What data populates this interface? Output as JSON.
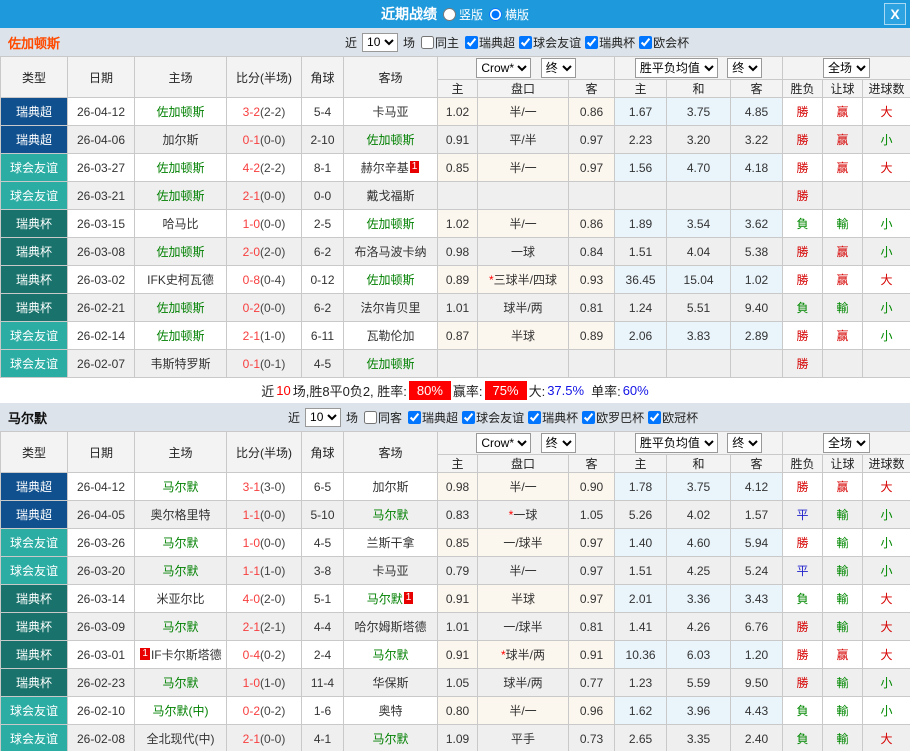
{
  "titlebar": {
    "title": "近期战绩",
    "layout_options": [
      {
        "label": "竖版",
        "checked": false
      },
      {
        "label": "横版",
        "checked": true
      }
    ],
    "close_label": "X"
  },
  "colors": {
    "header_blue": "#1e9adc",
    "section_bar": "#dce3ea",
    "league_superettan_blue": "#10508e",
    "friendly_teal": "#2bada4",
    "cup_dark_teal": "#19736c",
    "win_red": "#d60000",
    "lose_green": "#008800",
    "draw_blue": "#2222cc",
    "focus_team_green": "#008000",
    "score_red": "#f83e3e"
  },
  "table_header": {
    "type": "类型",
    "date": "日期",
    "home": "主场",
    "score": "比分(半场)",
    "corner": "角球",
    "away": "客场",
    "odds_select": "Crow*",
    "final_select": "终",
    "avg_select": "胜平负均值",
    "final_select2": "终",
    "full_select": "全场",
    "sub": [
      "主",
      "盘口",
      "客",
      "主",
      "和",
      "客",
      "胜负",
      "让球",
      "进球数"
    ]
  },
  "sections": [
    {
      "team": "佐加顿斯",
      "filter": {
        "near": "近",
        "count": "10",
        "unit": "场",
        "same": "同主",
        "same_checked": false,
        "leagues": [
          {
            "label": "瑞典超",
            "checked": true
          },
          {
            "label": "球会友谊",
            "checked": true
          },
          {
            "label": "瑞典杯",
            "checked": true
          },
          {
            "label": "欧会杯",
            "checked": true
          }
        ]
      },
      "rows": [
        {
          "type": "瑞典超",
          "type_color": "#10508e",
          "date": "26-04-12",
          "home": "佐加顿斯",
          "home_green": true,
          "away": "卡马亚",
          "away_green": false,
          "score": "3-2",
          "half": "(2-2)",
          "corner": "5-4",
          "water_home": "1.02",
          "handicap": "半/一",
          "water_away": "0.86",
          "avg_home": "1.67",
          "avg_draw": "3.75",
          "avg_away": "4.85",
          "outcome": "勝",
          "outcome_color": "#d60000",
          "cover": "赢",
          "cover_color": "#d60000",
          "size": "大",
          "size_color": "#d60000"
        },
        {
          "type": "瑞典超",
          "type_color": "#10508e",
          "date": "26-04-06",
          "home": "加尔斯",
          "home_green": false,
          "away": "佐加顿斯",
          "away_green": true,
          "score": "0-1",
          "half": "(0-0)",
          "corner": "2-10",
          "water_home": "0.91",
          "handicap": "平/半",
          "water_away": "0.97",
          "avg_home": "2.23",
          "avg_draw": "3.20",
          "avg_away": "3.22",
          "outcome": "勝",
          "outcome_color": "#d60000",
          "cover": "赢",
          "cover_color": "#d60000",
          "size": "小",
          "size_color": "#008800"
        },
        {
          "type": "球会友谊",
          "type_color": "#2bada4",
          "date": "26-03-27",
          "home": "佐加顿斯",
          "home_green": true,
          "away": "赫尔辛基",
          "away_green": false,
          "away_badge": "1",
          "score": "4-2",
          "half": "(2-2)",
          "corner": "8-1",
          "water_home": "0.85",
          "handicap": "半/一",
          "water_away": "0.97",
          "avg_home": "1.56",
          "avg_draw": "4.70",
          "avg_away": "4.18",
          "outcome": "勝",
          "outcome_color": "#d60000",
          "cover": "赢",
          "cover_color": "#d60000",
          "size": "大",
          "size_color": "#d60000"
        },
        {
          "type": "球会友谊",
          "type_color": "#2bada4",
          "date": "26-03-21",
          "home": "佐加顿斯",
          "home_green": true,
          "away": "戴戈福斯",
          "away_green": false,
          "score": "2-1",
          "half": "(0-0)",
          "corner": "0-0",
          "water_home": "",
          "handicap": "",
          "water_away": "",
          "avg_home": "",
          "avg_draw": "",
          "avg_away": "",
          "outcome": "勝",
          "outcome_color": "#d60000",
          "cover": "",
          "cover_color": "#333333",
          "size": "",
          "size_color": "#333333"
        },
        {
          "type": "瑞典杯",
          "type_color": "#19736c",
          "date": "26-03-15",
          "home": "哈马比",
          "home_green": false,
          "away": "佐加顿斯",
          "away_green": true,
          "score": "1-0",
          "half": "(0-0)",
          "corner": "2-5",
          "water_home": "1.02",
          "handicap": "半/一",
          "water_away": "0.86",
          "avg_home": "1.89",
          "avg_draw": "3.54",
          "avg_away": "3.62",
          "outcome": "負",
          "outcome_color": "#008800",
          "cover": "輸",
          "cover_color": "#008800",
          "size": "小",
          "size_color": "#008800"
        },
        {
          "type": "瑞典杯",
          "type_color": "#19736c",
          "date": "26-03-08",
          "home": "佐加顿斯",
          "home_green": true,
          "away": "布洛马波卡纳",
          "away_green": false,
          "score": "2-0",
          "half": "(2-0)",
          "corner": "6-2",
          "water_home": "0.98",
          "handicap": "一球",
          "water_away": "0.84",
          "avg_home": "1.51",
          "avg_draw": "4.04",
          "avg_away": "5.38",
          "outcome": "勝",
          "outcome_color": "#d60000",
          "cover": "赢",
          "cover_color": "#d60000",
          "size": "小",
          "size_color": "#008800"
        },
        {
          "type": "瑞典杯",
          "type_color": "#19736c",
          "date": "26-03-02",
          "home": "IFK史柯瓦德",
          "home_green": false,
          "away": "佐加顿斯",
          "away_green": true,
          "score": "0-8",
          "half": "(0-4)",
          "corner": "0-12",
          "water_home": "0.89",
          "handicap_star": "*",
          "handicap": "三球半/四球",
          "water_away": "0.93",
          "avg_home": "36.45",
          "avg_draw": "15.04",
          "avg_away": "1.02",
          "outcome": "勝",
          "outcome_color": "#d60000",
          "cover": "赢",
          "cover_color": "#d60000",
          "size": "大",
          "size_color": "#d60000"
        },
        {
          "type": "瑞典杯",
          "type_color": "#19736c",
          "date": "26-02-21",
          "home": "佐加顿斯",
          "home_green": true,
          "away": "法尔肯贝里",
          "away_green": false,
          "score": "0-2",
          "half": "(0-0)",
          "corner": "6-2",
          "water_home": "1.01",
          "handicap": "球半/两",
          "water_away": "0.81",
          "avg_home": "1.24",
          "avg_draw": "5.51",
          "avg_away": "9.40",
          "outcome": "負",
          "outcome_color": "#008800",
          "cover": "輸",
          "cover_color": "#008800",
          "size": "小",
          "size_color": "#008800"
        },
        {
          "type": "球会友谊",
          "type_color": "#2bada4",
          "date": "26-02-14",
          "home": "佐加顿斯",
          "home_green": true,
          "away": "瓦勒伦加",
          "away_green": false,
          "score": "2-1",
          "half": "(1-0)",
          "corner": "6-11",
          "water_home": "0.87",
          "handicap": "半球",
          "water_away": "0.89",
          "avg_home": "2.06",
          "avg_draw": "3.83",
          "avg_away": "2.89",
          "outcome": "勝",
          "outcome_color": "#d60000",
          "cover": "赢",
          "cover_color": "#d60000",
          "size": "小",
          "size_color": "#008800"
        },
        {
          "type": "球会友谊",
          "type_color": "#2bada4",
          "date": "26-02-07",
          "home": "韦斯特罗斯",
          "home_green": false,
          "away": "佐加顿斯",
          "away_green": true,
          "score": "0-1",
          "half": "(0-1)",
          "corner": "4-5",
          "water_home": "",
          "handicap": "",
          "water_away": "",
          "avg_home": "",
          "avg_draw": "",
          "avg_away": "",
          "outcome": "勝",
          "outcome_color": "#d60000",
          "cover": "",
          "cover_color": "#333333",
          "size": "",
          "size_color": "#333333"
        }
      ],
      "summary": {
        "near": "近",
        "count": "10",
        "after_count": "场,胜8平0负2, 胜率:",
        "win_rate": "80%",
        "cover_label": "赢率:",
        "cover_rate": "75%",
        "big_label": "大:",
        "big_value": "37.5%",
        "single_label": "单率:",
        "single_value": "60%"
      }
    },
    {
      "team": "马尔默",
      "filter": {
        "near": "近",
        "count": "10",
        "unit": "场",
        "same": "同客",
        "same_checked": false,
        "leagues": [
          {
            "label": "瑞典超",
            "checked": true
          },
          {
            "label": "球会友谊",
            "checked": true
          },
          {
            "label": "瑞典杯",
            "checked": true
          },
          {
            "label": "欧罗巴杯",
            "checked": true
          },
          {
            "label": "欧冠杯",
            "checked": true
          }
        ]
      },
      "rows": [
        {
          "type": "瑞典超",
          "type_color": "#10508e",
          "date": "26-04-12",
          "home": "马尔默",
          "home_green": true,
          "away": "加尔斯",
          "away_green": false,
          "score": "3-1",
          "half": "(3-0)",
          "corner": "6-5",
          "water_home": "0.98",
          "handicap": "半/一",
          "water_away": "0.90",
          "avg_home": "1.78",
          "avg_draw": "3.75",
          "avg_away": "4.12",
          "outcome": "勝",
          "outcome_color": "#d60000",
          "cover": "赢",
          "cover_color": "#d60000",
          "size": "大",
          "size_color": "#d60000"
        },
        {
          "type": "瑞典超",
          "type_color": "#10508e",
          "date": "26-04-05",
          "home": "奥尔格里特",
          "home_green": false,
          "away": "马尔默",
          "away_green": true,
          "score": "1-1",
          "half": "(0-0)",
          "corner": "5-10",
          "water_home": "0.83",
          "handicap_star": "*",
          "handicap": "一球",
          "water_away": "1.05",
          "avg_home": "5.26",
          "avg_draw": "4.02",
          "avg_away": "1.57",
          "outcome": "平",
          "outcome_color": "#2222cc",
          "cover": "輸",
          "cover_color": "#008800",
          "size": "小",
          "size_color": "#008800"
        },
        {
          "type": "球会友谊",
          "type_color": "#2bada4",
          "date": "26-03-26",
          "home": "马尔默",
          "home_green": true,
          "away": "兰斯干拿",
          "away_green": false,
          "score": "1-0",
          "half": "(0-0)",
          "corner": "4-5",
          "water_home": "0.85",
          "handicap": "一/球半",
          "water_away": "0.97",
          "avg_home": "1.40",
          "avg_draw": "4.60",
          "avg_away": "5.94",
          "outcome": "勝",
          "outcome_color": "#d60000",
          "cover": "輸",
          "cover_color": "#008800",
          "size": "小",
          "size_color": "#008800"
        },
        {
          "type": "球会友谊",
          "type_color": "#2bada4",
          "date": "26-03-20",
          "home": "马尔默",
          "home_green": true,
          "away": "卡马亚",
          "away_green": false,
          "score": "1-1",
          "half": "(1-0)",
          "corner": "3-8",
          "water_home": "0.79",
          "handicap": "半/一",
          "water_away": "0.97",
          "avg_home": "1.51",
          "avg_draw": "4.25",
          "avg_away": "5.24",
          "outcome": "平",
          "outcome_color": "#2222cc",
          "cover": "輸",
          "cover_color": "#008800",
          "size": "小",
          "size_color": "#008800"
        },
        {
          "type": "瑞典杯",
          "type_color": "#19736c",
          "date": "26-03-14",
          "home": "米亚尔比",
          "home_green": false,
          "away": "马尔默",
          "away_green": true,
          "away_badge": "1",
          "score": "4-0",
          "half": "(2-0)",
          "corner": "5-1",
          "water_home": "0.91",
          "handicap": "半球",
          "water_away": "0.97",
          "avg_home": "2.01",
          "avg_draw": "3.36",
          "avg_away": "3.43",
          "outcome": "負",
          "outcome_color": "#008800",
          "cover": "輸",
          "cover_color": "#008800",
          "size": "大",
          "size_color": "#d60000"
        },
        {
          "type": "瑞典杯",
          "type_color": "#19736c",
          "date": "26-03-09",
          "home": "马尔默",
          "home_green": true,
          "away": "哈尔姆斯塔德",
          "away_green": false,
          "score": "2-1",
          "half": "(2-1)",
          "corner": "4-4",
          "water_home": "1.01",
          "handicap": "一/球半",
          "water_away": "0.81",
          "avg_home": "1.41",
          "avg_draw": "4.26",
          "avg_away": "6.76",
          "outcome": "勝",
          "outcome_color": "#d60000",
          "cover": "輸",
          "cover_color": "#008800",
          "size": "大",
          "size_color": "#d60000"
        },
        {
          "type": "瑞典杯",
          "type_color": "#19736c",
          "date": "26-03-01",
          "home": "IF卡尔斯塔德",
          "home_green": false,
          "home_badge_before": "1",
          "away": "马尔默",
          "away_green": true,
          "score": "0-4",
          "half": "(0-2)",
          "corner": "2-4",
          "water_home": "0.91",
          "handicap_star": "*",
          "handicap": "球半/两",
          "water_away": "0.91",
          "avg_home": "10.36",
          "avg_draw": "6.03",
          "avg_away": "1.20",
          "outcome": "勝",
          "outcome_color": "#d60000",
          "cover": "赢",
          "cover_color": "#d60000",
          "size": "大",
          "size_color": "#d60000"
        },
        {
          "type": "瑞典杯",
          "type_color": "#19736c",
          "date": "26-02-23",
          "home": "马尔默",
          "home_green": true,
          "away": "华保斯",
          "away_green": false,
          "score": "1-0",
          "half": "(1-0)",
          "corner": "11-4",
          "water_home": "1.05",
          "handicap": "球半/两",
          "water_away": "0.77",
          "avg_home": "1.23",
          "avg_draw": "5.59",
          "avg_away": "9.50",
          "outcome": "勝",
          "outcome_color": "#d60000",
          "cover": "輸",
          "cover_color": "#008800",
          "size": "小",
          "size_color": "#008800"
        },
        {
          "type": "球会友谊",
          "type_color": "#2bada4",
          "date": "26-02-10",
          "home": "马尔默(中)",
          "home_green": true,
          "away": "奥特",
          "away_green": false,
          "score": "0-2",
          "half": "(0-2)",
          "corner": "1-6",
          "water_home": "0.80",
          "handicap": "半/一",
          "water_away": "0.96",
          "avg_home": "1.62",
          "avg_draw": "3.96",
          "avg_away": "4.43",
          "outcome": "負",
          "outcome_color": "#008800",
          "cover": "輸",
          "cover_color": "#008800",
          "size": "小",
          "size_color": "#008800"
        },
        {
          "type": "球会友谊",
          "type_color": "#2bada4",
          "date": "26-02-08",
          "home": "全北现代(中)",
          "home_green": false,
          "away": "马尔默",
          "away_green": true,
          "score": "2-1",
          "half": "(0-0)",
          "corner": "4-1",
          "water_home": "1.09",
          "handicap": "平手",
          "water_away": "0.73",
          "avg_home": "2.65",
          "avg_draw": "3.35",
          "avg_away": "2.40",
          "outcome": "負",
          "outcome_color": "#008800",
          "cover": "輸",
          "cover_color": "#008800",
          "size": "大",
          "size_color": "#d60000"
        }
      ],
      "summary": null
    }
  ]
}
